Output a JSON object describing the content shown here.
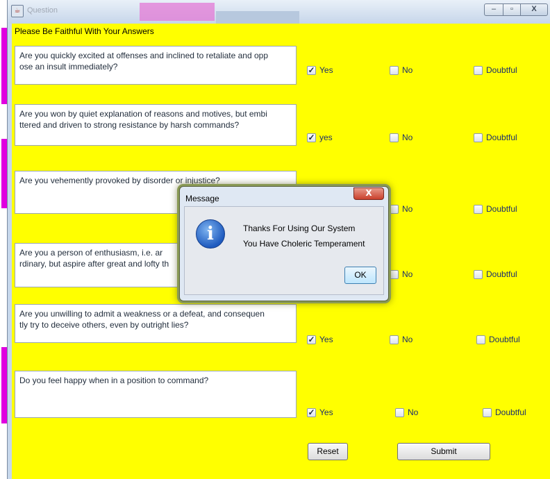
{
  "window": {
    "title": "Question",
    "controls": {
      "minimize": "–",
      "maximize": "▫",
      "close": "X"
    }
  },
  "heading": "Please Be Faithful With Your Answers",
  "questions": [
    {
      "text": "Are you quickly excited at offenses and inclined to retaliate and opp\nose an insult immediately?",
      "options": [
        {
          "label": "Yes",
          "checked": true
        },
        {
          "label": "No",
          "checked": false
        },
        {
          "label": "Doubtful",
          "checked": false
        }
      ]
    },
    {
      "text": "Are you won by quiet explanation of reasons and motives, but embi\nttered and driven to strong resistance by harsh commands?",
      "options": [
        {
          "label": "yes",
          "checked": true
        },
        {
          "label": "No",
          "checked": false
        },
        {
          "label": "Doubtful",
          "checked": false
        }
      ]
    },
    {
      "text": "Are you vehemently provoked by disorder or injustice?",
      "options": [
        {
          "label": "No",
          "checked": false
        },
        {
          "label": "Doubtful",
          "checked": false
        }
      ]
    },
    {
      "text": "Are you a person of enthusiasm, i.e. ar\nrdinary, but aspire after great and lofty th",
      "options": [
        {
          "label": "No",
          "checked": false
        },
        {
          "label": "Doubtful",
          "checked": false
        }
      ]
    },
    {
      "text": "Are you unwilling to admit a weakness or a defeat, and consequen\ntly try to deceive others, even by outright lies?",
      "options": [
        {
          "label": "Yes",
          "checked": true
        },
        {
          "label": "No",
          "checked": false
        },
        {
          "label": "Doubtful",
          "checked": false
        }
      ]
    },
    {
      "text": "Do you feel happy when in a position to command?",
      "options": [
        {
          "label": "Yes",
          "checked": true
        },
        {
          "label": "No",
          "checked": false
        },
        {
          "label": "Doubtful",
          "checked": false
        }
      ]
    }
  ],
  "buttons": {
    "reset": "Reset",
    "submit": "Submit"
  },
  "dialog": {
    "title": "Message",
    "close": "X",
    "icon": "info-icon",
    "line1": "Thanks For Using Our System",
    "line2": "You Have Choleric Temperament",
    "ok": "OK"
  }
}
